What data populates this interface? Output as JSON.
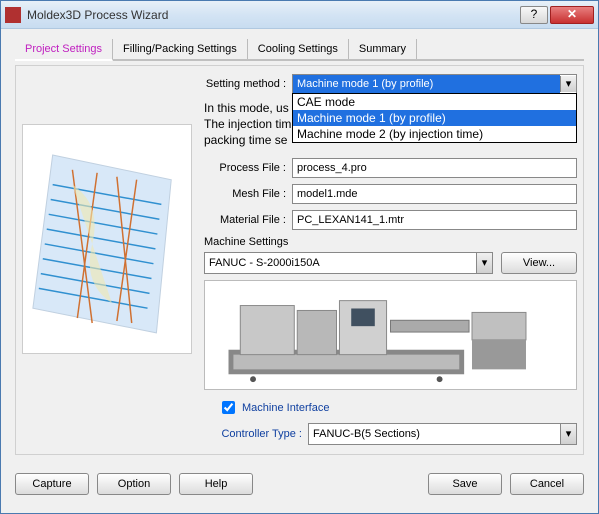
{
  "window": {
    "title": "Moldex3D Process Wizard"
  },
  "tabs": {
    "project": "Project Settings",
    "filling": "Filling/Packing Settings",
    "cooling": "Cooling Settings",
    "summary": "Summary"
  },
  "labels": {
    "setting_method": "Setting method :",
    "process_file": "Process File :",
    "mesh_file": "Mesh File :",
    "material_file": "Material File :",
    "machine_settings": "Machine Settings",
    "view": "View...",
    "machine_interface": "Machine Interface",
    "controller_type": "Controller Type :"
  },
  "fields": {
    "setting_method_value": "Machine mode 1 (by profile)",
    "process_file_value": "process_4.pro",
    "mesh_file_value": "model1.mde",
    "material_file_value": "PC_LEXAN141_1.mtr",
    "machine_value": "FANUC - S-2000i150A",
    "controller_value": "FANUC-B(5 Sections)"
  },
  "dropdown_options": {
    "opt1": "CAE mode",
    "opt2": "Machine mode 1 (by profile)",
    "opt3": "Machine mode 2 (by injection time)"
  },
  "infotext": {
    "line1": "In this mode, us",
    "line2": "The injection tim",
    "line3": " packing time se"
  },
  "footer": {
    "capture": "Capture",
    "option": "Option",
    "help": "Help",
    "save": "Save",
    "cancel": "Cancel"
  },
  "icons": {
    "help": "?",
    "close": "✕",
    "arrow_down": "▾"
  }
}
